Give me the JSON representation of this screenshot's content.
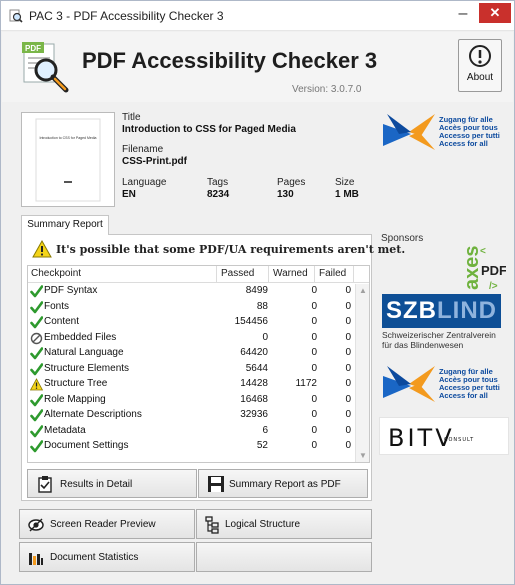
{
  "window": {
    "title": "PAC 3 - PDF Accessibility Checker 3",
    "minimize": "–",
    "close": "✕"
  },
  "header": {
    "app_title": "PDF Accessibility Checker 3",
    "version": "Version: 3.0.7.0",
    "about_label": "About",
    "logo_badge": "PDF"
  },
  "thumbnail": {
    "title_text": "Introduction to CSS for Paged Media"
  },
  "document": {
    "title_label": "Title",
    "title": "Introduction to CSS for Paged Media",
    "filename_label": "Filename",
    "filename": "CSS-Print.pdf",
    "language_label": "Language",
    "language": "EN",
    "tags_label": "Tags",
    "tags": "8234",
    "pages_label": "Pages",
    "pages": "130",
    "size_label": "Size",
    "size": "1 MB"
  },
  "summary": {
    "tab_label": "Summary Report",
    "warning": "It's possible that some PDF/UA requirements aren't met.",
    "columns": [
      "Checkpoint",
      "Passed",
      "Warned",
      "Failed"
    ],
    "rows": [
      {
        "status": "check-icon",
        "name": "PDF Syntax",
        "passed": "8499",
        "warned": "0",
        "failed": "0"
      },
      {
        "status": "check-icon",
        "name": "Fonts",
        "passed": "88",
        "warned": "0",
        "failed": "0"
      },
      {
        "status": "check-icon",
        "name": "Content",
        "passed": "154456",
        "warned": "0",
        "failed": "0"
      },
      {
        "status": "na-icon",
        "name": "Embedded Files",
        "passed": "0",
        "warned": "0",
        "failed": "0"
      },
      {
        "status": "check-icon",
        "name": "Natural Language",
        "passed": "64420",
        "warned": "0",
        "failed": "0"
      },
      {
        "status": "check-icon",
        "name": "Structure Elements",
        "passed": "5644",
        "warned": "0",
        "failed": "0"
      },
      {
        "status": "warning-icon",
        "name": "Structure Tree",
        "passed": "14428",
        "warned": "1172",
        "failed": "0"
      },
      {
        "status": "check-icon",
        "name": "Role Mapping",
        "passed": "16468",
        "warned": "0",
        "failed": "0"
      },
      {
        "status": "check-icon",
        "name": "Alternate Descriptions",
        "passed": "32936",
        "warned": "0",
        "failed": "0"
      },
      {
        "status": "check-icon",
        "name": "Metadata",
        "passed": "6",
        "warned": "0",
        "failed": "0"
      },
      {
        "status": "check-icon",
        "name": "Document Settings",
        "passed": "52",
        "warned": "0",
        "failed": "0"
      }
    ],
    "results_button": "Results in Detail",
    "pdf_button": "Summary Report as PDF"
  },
  "tools": {
    "screen_reader": "Screen Reader Preview",
    "logical_structure": "Logical Structure",
    "doc_stats": "Document Statistics"
  },
  "sponsors": {
    "label": "Sponsors",
    "zugang_lines": [
      "Zugang für alle",
      "Accès pour tous",
      "Accesso per tutti",
      "Access for all"
    ],
    "axes_text": "axes",
    "axes_pdf": "PDF",
    "szb_dark": "SZB",
    "szb_light": "LIND",
    "szb_sub": "Schweizerischer Zentralverein für das Blindenwesen",
    "bitv_big": "BITV",
    "bitv_small": "CONSULT"
  },
  "colors": {
    "check": "#2e9a2e",
    "warn_yellow": "#f4d418",
    "close_red": "#c9302c",
    "brand_blue": "#0c4a9e",
    "accent_orange": "#f39a1e"
  }
}
